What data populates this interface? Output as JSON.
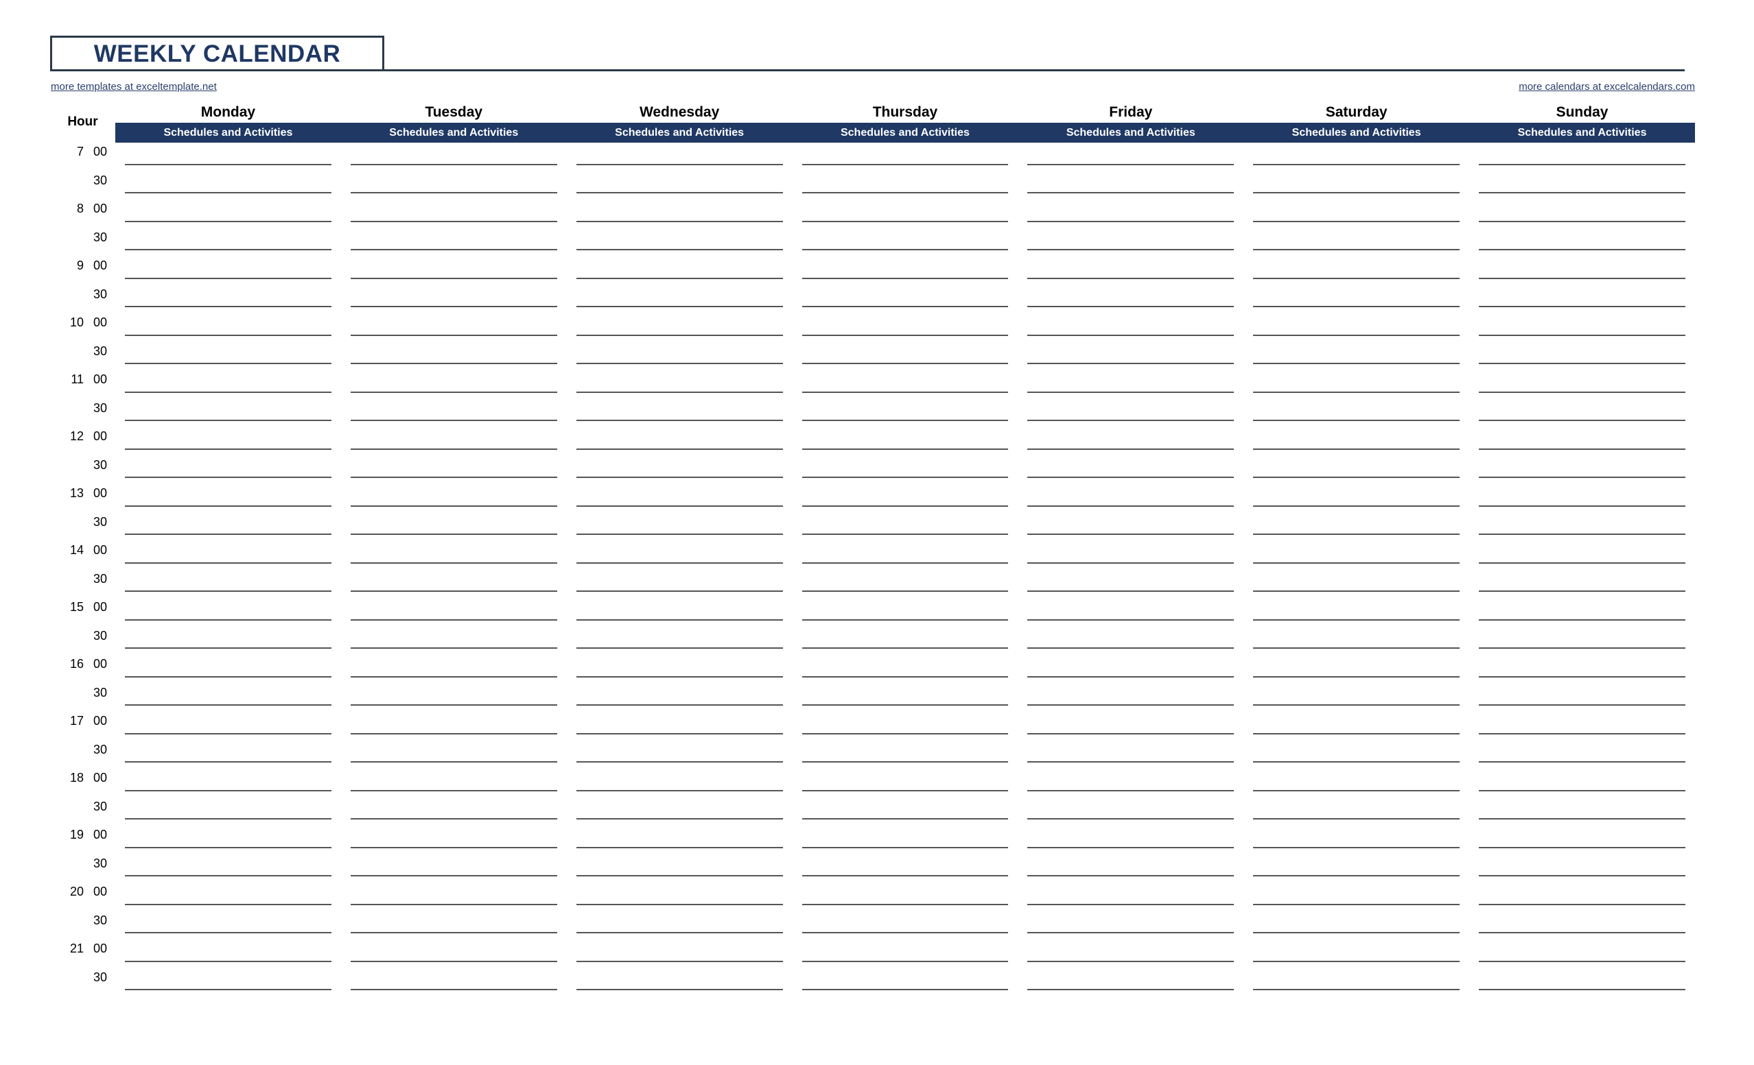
{
  "header": {
    "title": "WEEKLY CALENDAR",
    "link_left": "more templates at exceltemplate.net",
    "link_right": "more calendars at excelcalendars.com",
    "accent_navy": "#1F3864",
    "border_dark": "#1A1A1A",
    "line_gray": "#555555"
  },
  "table": {
    "hour_header": "Hour",
    "sub_header": "Schedules and Activities",
    "days": [
      "Monday",
      "Tuesday",
      "Wednesday",
      "Thursday",
      "Friday",
      "Saturday",
      "Sunday"
    ],
    "rows": [
      {
        "hour": "7",
        "minute": "00"
      },
      {
        "hour": "",
        "minute": "30"
      },
      {
        "hour": "8",
        "minute": "00"
      },
      {
        "hour": "",
        "minute": "30"
      },
      {
        "hour": "9",
        "minute": "00"
      },
      {
        "hour": "",
        "minute": "30"
      },
      {
        "hour": "10",
        "minute": "00"
      },
      {
        "hour": "",
        "minute": "30"
      },
      {
        "hour": "11",
        "minute": "00"
      },
      {
        "hour": "",
        "minute": "30"
      },
      {
        "hour": "12",
        "minute": "00"
      },
      {
        "hour": "",
        "minute": "30"
      },
      {
        "hour": "13",
        "minute": "00"
      },
      {
        "hour": "",
        "minute": "30"
      },
      {
        "hour": "14",
        "minute": "00"
      },
      {
        "hour": "",
        "minute": "30"
      },
      {
        "hour": "15",
        "minute": "00"
      },
      {
        "hour": "",
        "minute": "30"
      },
      {
        "hour": "16",
        "minute": "00"
      },
      {
        "hour": "",
        "minute": "30"
      },
      {
        "hour": "17",
        "minute": "00"
      },
      {
        "hour": "",
        "minute": "30"
      },
      {
        "hour": "18",
        "minute": "00"
      },
      {
        "hour": "",
        "minute": "30"
      },
      {
        "hour": "19",
        "minute": "00"
      },
      {
        "hour": "",
        "minute": "30"
      },
      {
        "hour": "20",
        "minute": "00"
      },
      {
        "hour": "",
        "minute": "30"
      },
      {
        "hour": "21",
        "minute": "00"
      },
      {
        "hour": "",
        "minute": "30"
      }
    ]
  }
}
